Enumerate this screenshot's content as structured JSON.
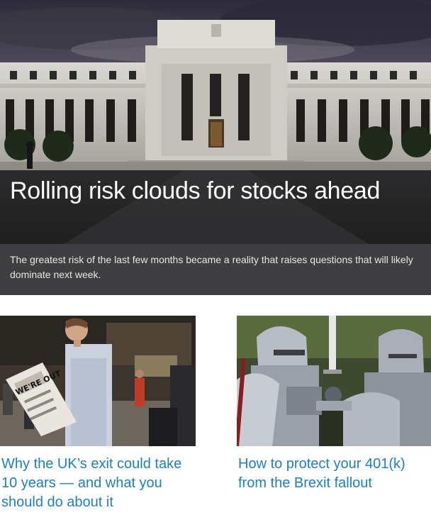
{
  "hero": {
    "title": "Rolling risk clouds for stocks ahead",
    "dek": "The greatest risk of the last few months became a reality that raises questions that will likely dominate next week."
  },
  "cards": [
    {
      "title": "Why the UK’s exit could take 10 years — and what you should do about it",
      "newspaper_headline": "WE'RE OUT"
    },
    {
      "title": "How to protect your 401(k) from the Brexit fallout"
    }
  ],
  "colors": {
    "link": "#1e80c0",
    "dek_bg": "#3f3f41",
    "hero_text": "#ffffff"
  }
}
